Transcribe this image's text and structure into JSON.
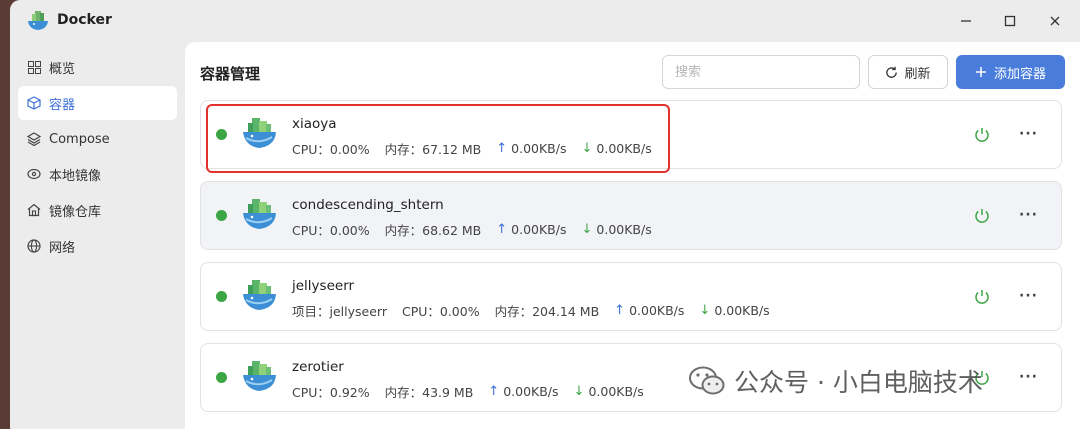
{
  "window": {
    "title": "Docker",
    "icon": "docker-whale-icon",
    "controls": [
      "minimize-icon",
      "maximize-icon",
      "close-icon"
    ]
  },
  "sidebar": {
    "items": [
      {
        "label": "概览",
        "icon": "grid-icon",
        "active": false
      },
      {
        "label": "容器",
        "icon": "cube-icon",
        "active": true
      },
      {
        "label": "Compose",
        "icon": "layers-icon",
        "active": false
      },
      {
        "label": "本地镜像",
        "icon": "disc-icon",
        "active": false
      },
      {
        "label": "镜像仓库",
        "icon": "house-icon",
        "active": false
      },
      {
        "label": "网络",
        "icon": "globe-icon",
        "active": false
      }
    ]
  },
  "main": {
    "title": "容器管理",
    "search": {
      "placeholder": "搜索",
      "value": ""
    },
    "refresh_label": "刷新",
    "add_label": "添加容器"
  },
  "containers": [
    {
      "name": "xiaoya",
      "status": "running",
      "cpu": "CPU：0.00%",
      "memory": "内存：67.12 MB",
      "up": "0.00KB/s",
      "down": "0.00KB/s",
      "highlighted": false
    },
    {
      "name": "condescending_shtern",
      "status": "running",
      "cpu": "CPU：0.00%",
      "memory": "内存：68.62 MB",
      "up": "0.00KB/s",
      "down": "0.00KB/s",
      "highlighted": true
    },
    {
      "name": "jellyseerr",
      "status": "running",
      "project": "项目：jellyseerr",
      "cpu": "CPU：0.00%",
      "memory": "内存：204.14 MB",
      "up": "0.00KB/s",
      "down": "0.00KB/s",
      "highlighted": false
    },
    {
      "name": "zerotier",
      "status": "running",
      "cpu": "CPU：0.92%",
      "memory": "内存：43.9 MB",
      "up": "0.00KB/s",
      "down": "0.00KB/s",
      "highlighted": false
    }
  ],
  "watermark": {
    "text": "公众号 · 小白电脑技术"
  },
  "colors": {
    "accent": "#4a7ddb",
    "running": "#3ca645",
    "annotation": "#e0322b"
  }
}
